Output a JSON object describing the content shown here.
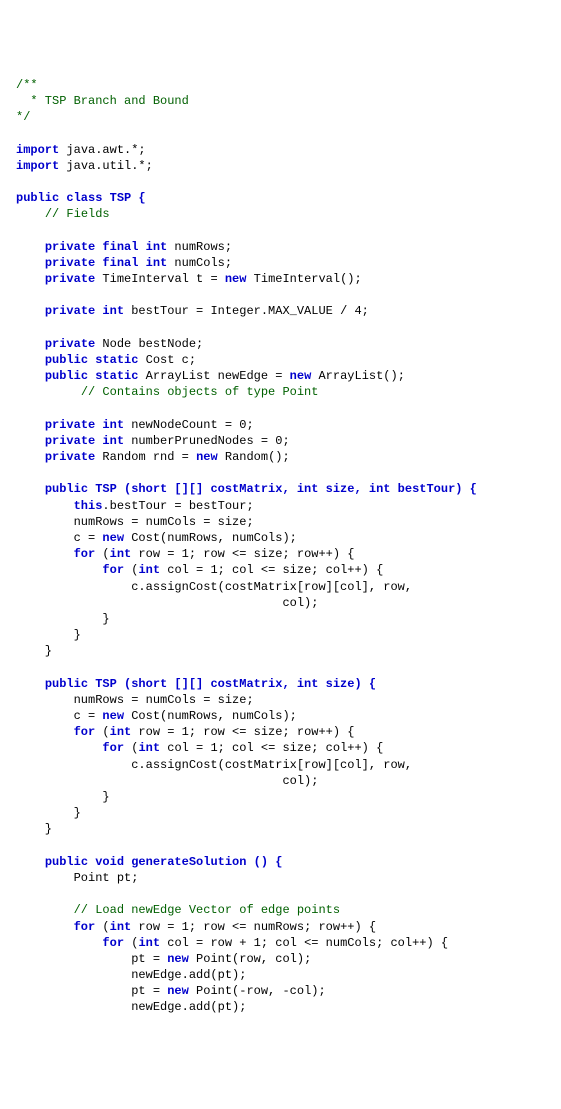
{
  "lines": [
    [
      {
        "cls": "c",
        "t": "/**"
      }
    ],
    [
      {
        "cls": "c",
        "t": "  * TSP Branch and Bound"
      }
    ],
    [
      {
        "cls": "c",
        "t": "*/"
      }
    ],
    [
      {
        "cls": "p",
        "t": ""
      }
    ],
    [
      {
        "cls": "k",
        "t": "import"
      },
      {
        "cls": "p",
        "t": " java.awt.*;"
      }
    ],
    [
      {
        "cls": "k",
        "t": "import"
      },
      {
        "cls": "p",
        "t": " java.util.*;"
      }
    ],
    [
      {
        "cls": "p",
        "t": ""
      }
    ],
    [
      {
        "cls": "k",
        "t": "public class TSP {"
      }
    ],
    [
      {
        "cls": "p",
        "t": "    "
      },
      {
        "cls": "c",
        "t": "// Fields"
      }
    ],
    [
      {
        "cls": "p",
        "t": ""
      }
    ],
    [
      {
        "cls": "p",
        "t": "    "
      },
      {
        "cls": "k",
        "t": "private final int"
      },
      {
        "cls": "p",
        "t": " numRows;"
      }
    ],
    [
      {
        "cls": "p",
        "t": "    "
      },
      {
        "cls": "k",
        "t": "private final int"
      },
      {
        "cls": "p",
        "t": " numCols;"
      }
    ],
    [
      {
        "cls": "p",
        "t": "    "
      },
      {
        "cls": "k",
        "t": "private"
      },
      {
        "cls": "p",
        "t": " TimeInterval t = "
      },
      {
        "cls": "k",
        "t": "new"
      },
      {
        "cls": "p",
        "t": " TimeInterval();"
      }
    ],
    [
      {
        "cls": "p",
        "t": ""
      }
    ],
    [
      {
        "cls": "p",
        "t": "    "
      },
      {
        "cls": "k",
        "t": "private int"
      },
      {
        "cls": "p",
        "t": " bestTour = Integer.MAX_VALUE / 4;"
      }
    ],
    [
      {
        "cls": "p",
        "t": ""
      }
    ],
    [
      {
        "cls": "p",
        "t": "    "
      },
      {
        "cls": "k",
        "t": "private"
      },
      {
        "cls": "p",
        "t": " Node bestNode;"
      }
    ],
    [
      {
        "cls": "p",
        "t": "    "
      },
      {
        "cls": "k",
        "t": "public static"
      },
      {
        "cls": "p",
        "t": " Cost c;"
      }
    ],
    [
      {
        "cls": "p",
        "t": "    "
      },
      {
        "cls": "k",
        "t": "public static"
      },
      {
        "cls": "p",
        "t": " ArrayList newEdge = "
      },
      {
        "cls": "k",
        "t": "new"
      },
      {
        "cls": "p",
        "t": " ArrayList();"
      }
    ],
    [
      {
        "cls": "p",
        "t": "         "
      },
      {
        "cls": "c",
        "t": "// Contains objects of type Point"
      }
    ],
    [
      {
        "cls": "p",
        "t": ""
      }
    ],
    [
      {
        "cls": "p",
        "t": "    "
      },
      {
        "cls": "k",
        "t": "private int"
      },
      {
        "cls": "p",
        "t": " newNodeCount = 0;"
      }
    ],
    [
      {
        "cls": "p",
        "t": "    "
      },
      {
        "cls": "k",
        "t": "private int"
      },
      {
        "cls": "p",
        "t": " numberPrunedNodes = 0;"
      }
    ],
    [
      {
        "cls": "p",
        "t": "    "
      },
      {
        "cls": "k",
        "t": "private"
      },
      {
        "cls": "p",
        "t": " Random rnd = "
      },
      {
        "cls": "k",
        "t": "new"
      },
      {
        "cls": "p",
        "t": " Random();"
      }
    ],
    [
      {
        "cls": "p",
        "t": ""
      }
    ],
    [
      {
        "cls": "p",
        "t": "    "
      },
      {
        "cls": "k",
        "t": "public TSP (short [][] costMatrix, int size, int bestTour) {"
      }
    ],
    [
      {
        "cls": "p",
        "t": "        "
      },
      {
        "cls": "k",
        "t": "this"
      },
      {
        "cls": "p",
        "t": ".bestTour = bestTour;"
      }
    ],
    [
      {
        "cls": "p",
        "t": "        numRows = numCols = size;"
      }
    ],
    [
      {
        "cls": "p",
        "t": "        c = "
      },
      {
        "cls": "k",
        "t": "new"
      },
      {
        "cls": "p",
        "t": " Cost(numRows, numCols);"
      }
    ],
    [
      {
        "cls": "p",
        "t": "        "
      },
      {
        "cls": "k",
        "t": "for"
      },
      {
        "cls": "p",
        "t": " ("
      },
      {
        "cls": "k",
        "t": "int"
      },
      {
        "cls": "p",
        "t": " row = 1; row <= size; row++) {"
      }
    ],
    [
      {
        "cls": "p",
        "t": "            "
      },
      {
        "cls": "k",
        "t": "for"
      },
      {
        "cls": "p",
        "t": " ("
      },
      {
        "cls": "k",
        "t": "int"
      },
      {
        "cls": "p",
        "t": " col = 1; col <= size; col++) {"
      }
    ],
    [
      {
        "cls": "p",
        "t": "                c.assignCost(costMatrix[row][col], row,"
      }
    ],
    [
      {
        "cls": "p",
        "t": "                                     col);"
      }
    ],
    [
      {
        "cls": "p",
        "t": "            }"
      }
    ],
    [
      {
        "cls": "p",
        "t": "        }"
      }
    ],
    [
      {
        "cls": "p",
        "t": "    }"
      }
    ],
    [
      {
        "cls": "p",
        "t": ""
      }
    ],
    [
      {
        "cls": "p",
        "t": "    "
      },
      {
        "cls": "k",
        "t": "public TSP (short [][] costMatrix, int size) {"
      }
    ],
    [
      {
        "cls": "p",
        "t": "        numRows = numCols = size;"
      }
    ],
    [
      {
        "cls": "p",
        "t": "        c = "
      },
      {
        "cls": "k",
        "t": "new"
      },
      {
        "cls": "p",
        "t": " Cost(numRows, numCols);"
      }
    ],
    [
      {
        "cls": "p",
        "t": "        "
      },
      {
        "cls": "k",
        "t": "for"
      },
      {
        "cls": "p",
        "t": " ("
      },
      {
        "cls": "k",
        "t": "int"
      },
      {
        "cls": "p",
        "t": " row = 1; row <= size; row++) {"
      }
    ],
    [
      {
        "cls": "p",
        "t": "            "
      },
      {
        "cls": "k",
        "t": "for"
      },
      {
        "cls": "p",
        "t": " ("
      },
      {
        "cls": "k",
        "t": "int"
      },
      {
        "cls": "p",
        "t": " col = 1; col <= size; col++) {"
      }
    ],
    [
      {
        "cls": "p",
        "t": "                c.assignCost(costMatrix[row][col], row,"
      }
    ],
    [
      {
        "cls": "p",
        "t": "                                     col);"
      }
    ],
    [
      {
        "cls": "p",
        "t": "            }"
      }
    ],
    [
      {
        "cls": "p",
        "t": "        }"
      }
    ],
    [
      {
        "cls": "p",
        "t": "    }"
      }
    ],
    [
      {
        "cls": "p",
        "t": ""
      }
    ],
    [
      {
        "cls": "p",
        "t": "    "
      },
      {
        "cls": "k",
        "t": "public void generateSolution () {"
      }
    ],
    [
      {
        "cls": "p",
        "t": "        Point pt;"
      }
    ],
    [
      {
        "cls": "p",
        "t": ""
      }
    ],
    [
      {
        "cls": "p",
        "t": "        "
      },
      {
        "cls": "c",
        "t": "// Load newEdge Vector of edge points"
      }
    ],
    [
      {
        "cls": "p",
        "t": "        "
      },
      {
        "cls": "k",
        "t": "for"
      },
      {
        "cls": "p",
        "t": " ("
      },
      {
        "cls": "k",
        "t": "int"
      },
      {
        "cls": "p",
        "t": " row = 1; row <= numRows; row++) {"
      }
    ],
    [
      {
        "cls": "p",
        "t": "            "
      },
      {
        "cls": "k",
        "t": "for"
      },
      {
        "cls": "p",
        "t": " ("
      },
      {
        "cls": "k",
        "t": "int"
      },
      {
        "cls": "p",
        "t": " col = row + 1; col <= numCols; col++) {"
      }
    ],
    [
      {
        "cls": "p",
        "t": "                pt = "
      },
      {
        "cls": "k",
        "t": "new"
      },
      {
        "cls": "p",
        "t": " Point(row, col);"
      }
    ],
    [
      {
        "cls": "p",
        "t": "                newEdge.add(pt);"
      }
    ],
    [
      {
        "cls": "p",
        "t": "                pt = "
      },
      {
        "cls": "k",
        "t": "new"
      },
      {
        "cls": "p",
        "t": " Point(-row, -col);"
      }
    ],
    [
      {
        "cls": "p",
        "t": "                newEdge.add(pt);"
      }
    ]
  ]
}
